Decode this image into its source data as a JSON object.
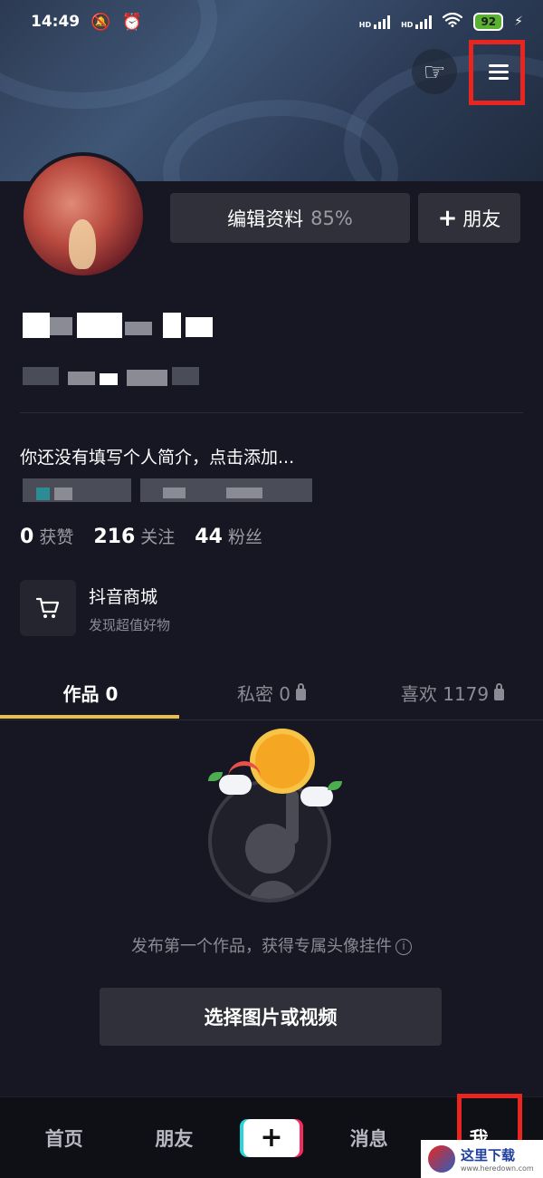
{
  "status_bar": {
    "time": "14:49",
    "network": "HD",
    "battery": "92"
  },
  "profile": {
    "edit_label": "编辑资料",
    "edit_progress": "85%",
    "add_friend_label": "朋友",
    "bio": "你还没有填写个人简介，点击添加..."
  },
  "stats": [
    {
      "value": "0",
      "label": "获赞"
    },
    {
      "value": "216",
      "label": "关注"
    },
    {
      "value": "44",
      "label": "粉丝"
    }
  ],
  "shop": {
    "title": "抖音商城",
    "subtitle": "发现超值好物"
  },
  "tabs": [
    {
      "label": "作品 0",
      "locked": false,
      "active": true
    },
    {
      "label": "私密 0",
      "locked": true,
      "active": false
    },
    {
      "label": "喜欢 1179",
      "locked": true,
      "active": false
    }
  ],
  "empty_state": {
    "message": "发布第一个作品，获得专属头像挂件",
    "button": "选择图片或视频"
  },
  "bottom_nav": [
    {
      "label": "首页",
      "active": false
    },
    {
      "label": "朋友",
      "active": false
    },
    {
      "label": "消息",
      "active": false
    },
    {
      "label": "我",
      "active": true
    }
  ],
  "watermark": {
    "title": "这里下载",
    "url": "www.heredown.com"
  },
  "colors": {
    "accent": "#e6c04a",
    "highlight_box": "#e8261f",
    "background": "#161722"
  }
}
